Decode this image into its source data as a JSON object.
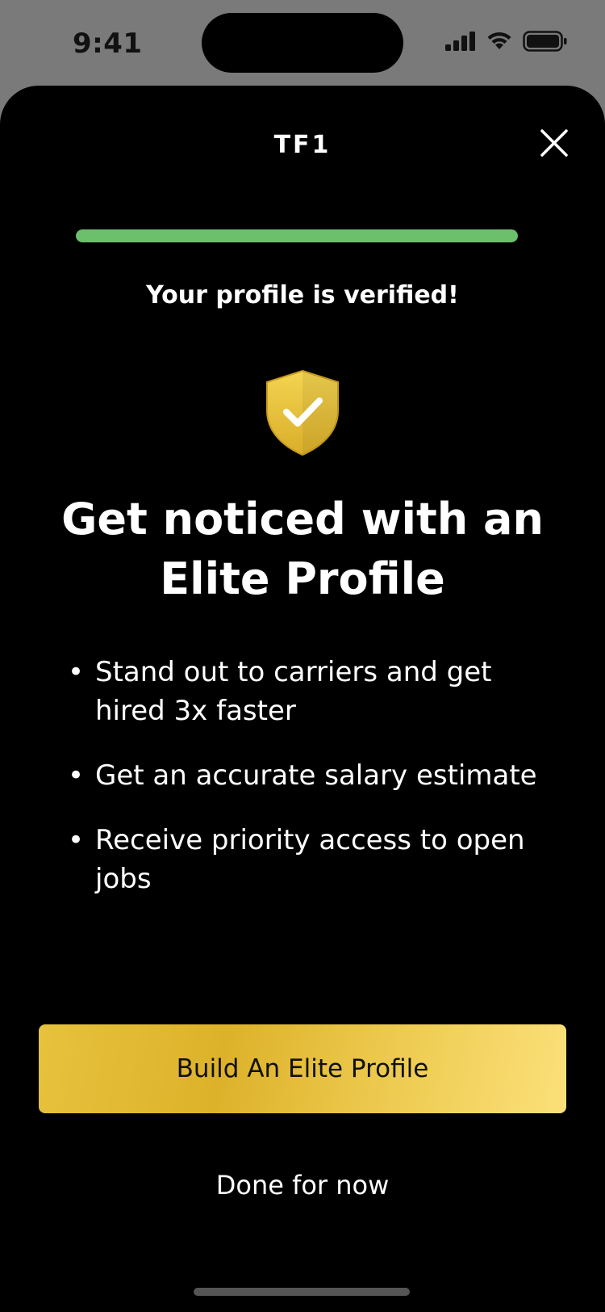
{
  "status_bar": {
    "time": "9:41",
    "icons": [
      "signal-icon",
      "wifi-icon",
      "battery-icon"
    ]
  },
  "header": {
    "brand": "TF1",
    "close_icon": "close-icon"
  },
  "progress": {
    "value": 1.0,
    "color": "#6cc06c"
  },
  "verification": {
    "message": "Your profile is verified!",
    "icon": "shield-check-icon"
  },
  "headline": "Get noticed with an Elite Profile",
  "benefits": [
    {
      "bullet": "•",
      "text": "Stand out to carriers and get hired 3x faster"
    },
    {
      "bullet": "•",
      "text": "Get an accurate salary estimate"
    },
    {
      "bullet": "•",
      "text": "Receive priority access to open jobs"
    }
  ],
  "actions": {
    "primary_label": "Build An Elite Profile",
    "secondary_label": "Done for now"
  },
  "colors": {
    "background": "#000000",
    "accent_gold": "#e7c23d",
    "success_green": "#6cc06c"
  }
}
